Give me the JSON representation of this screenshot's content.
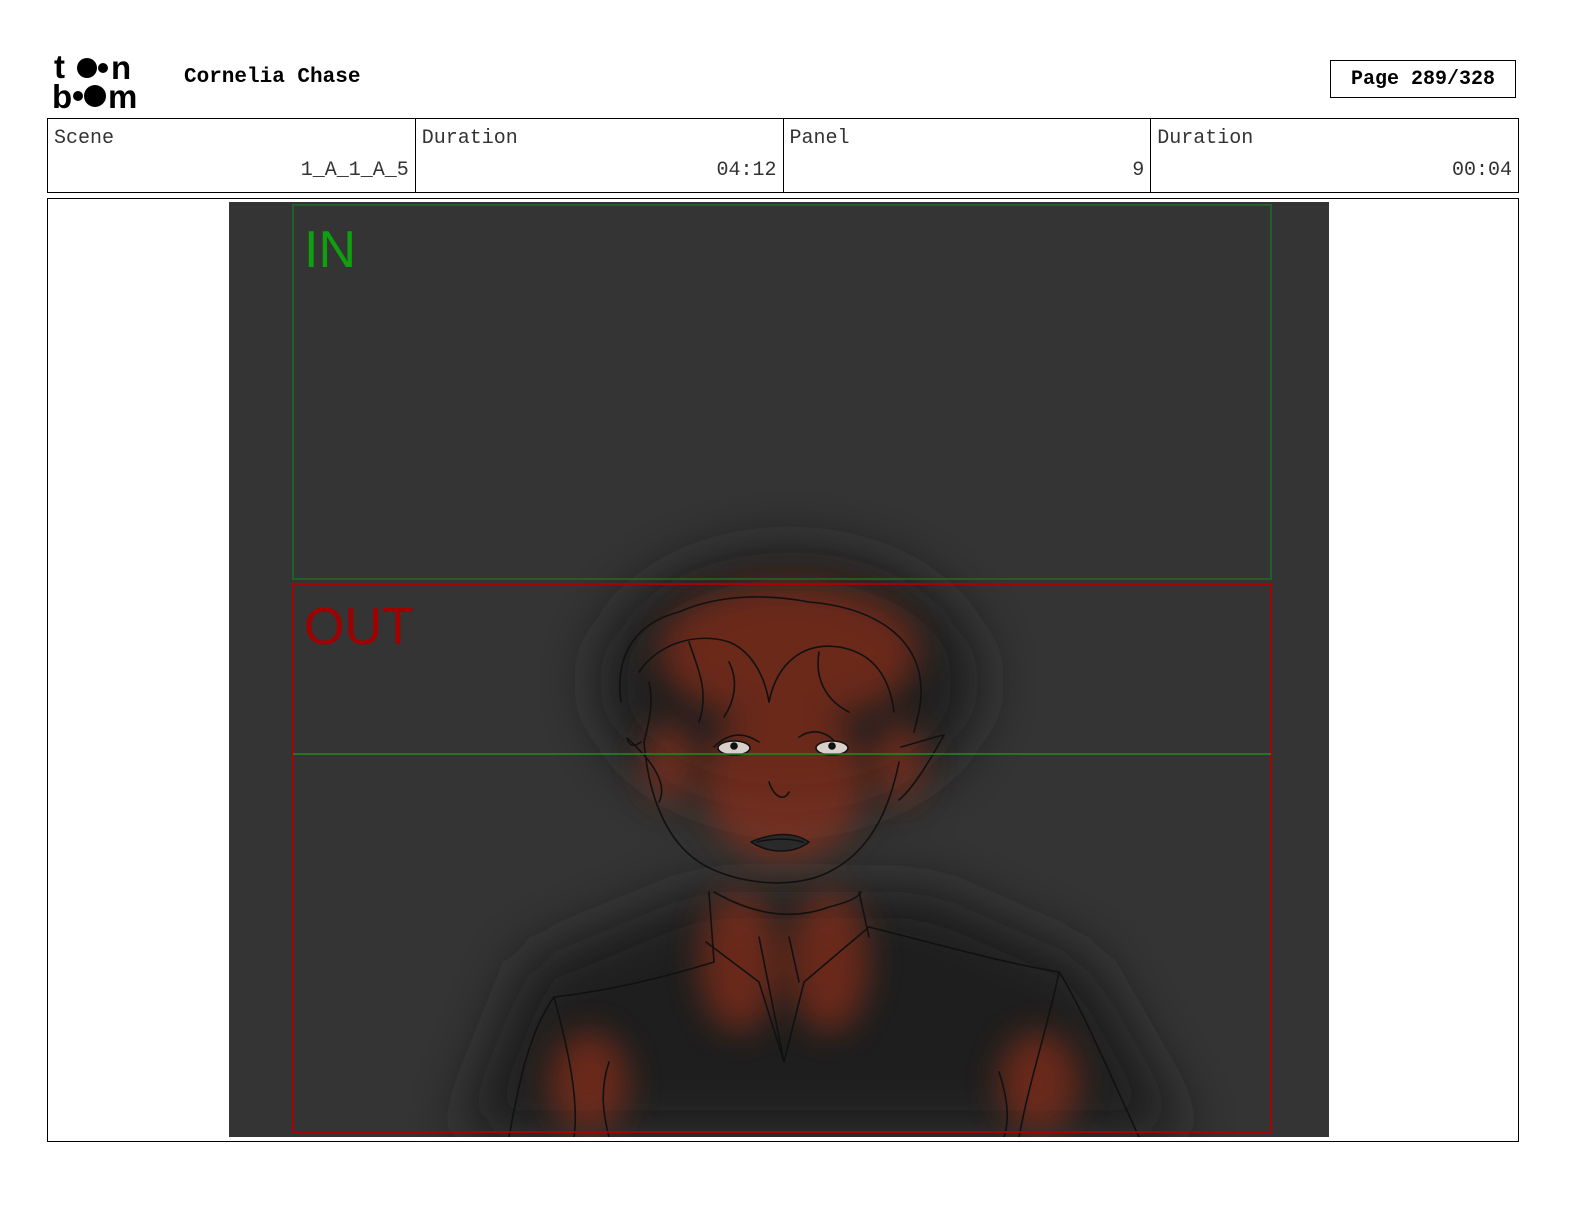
{
  "header": {
    "logo_text": "toon boom",
    "project_title": "Cornelia Chase",
    "page_label": "Page 289/328"
  },
  "info": {
    "scene_label": "Scene",
    "scene_value": "1_A_1_A_5",
    "scene_duration_label": "Duration",
    "scene_duration_value": "04:12",
    "panel_label": "Panel",
    "panel_value": "9",
    "panel_duration_label": "Duration",
    "panel_duration_value": "00:04"
  },
  "panel": {
    "in_label": "IN",
    "out_label": "OUT",
    "colors": {
      "background": "#343434",
      "in_frame": "#1f6b2a",
      "in_label": "#0fa00f",
      "out_frame": "#b00000",
      "out_label": "#a00000",
      "horizon": "#1f8a1f",
      "glow": "#a83318"
    }
  }
}
